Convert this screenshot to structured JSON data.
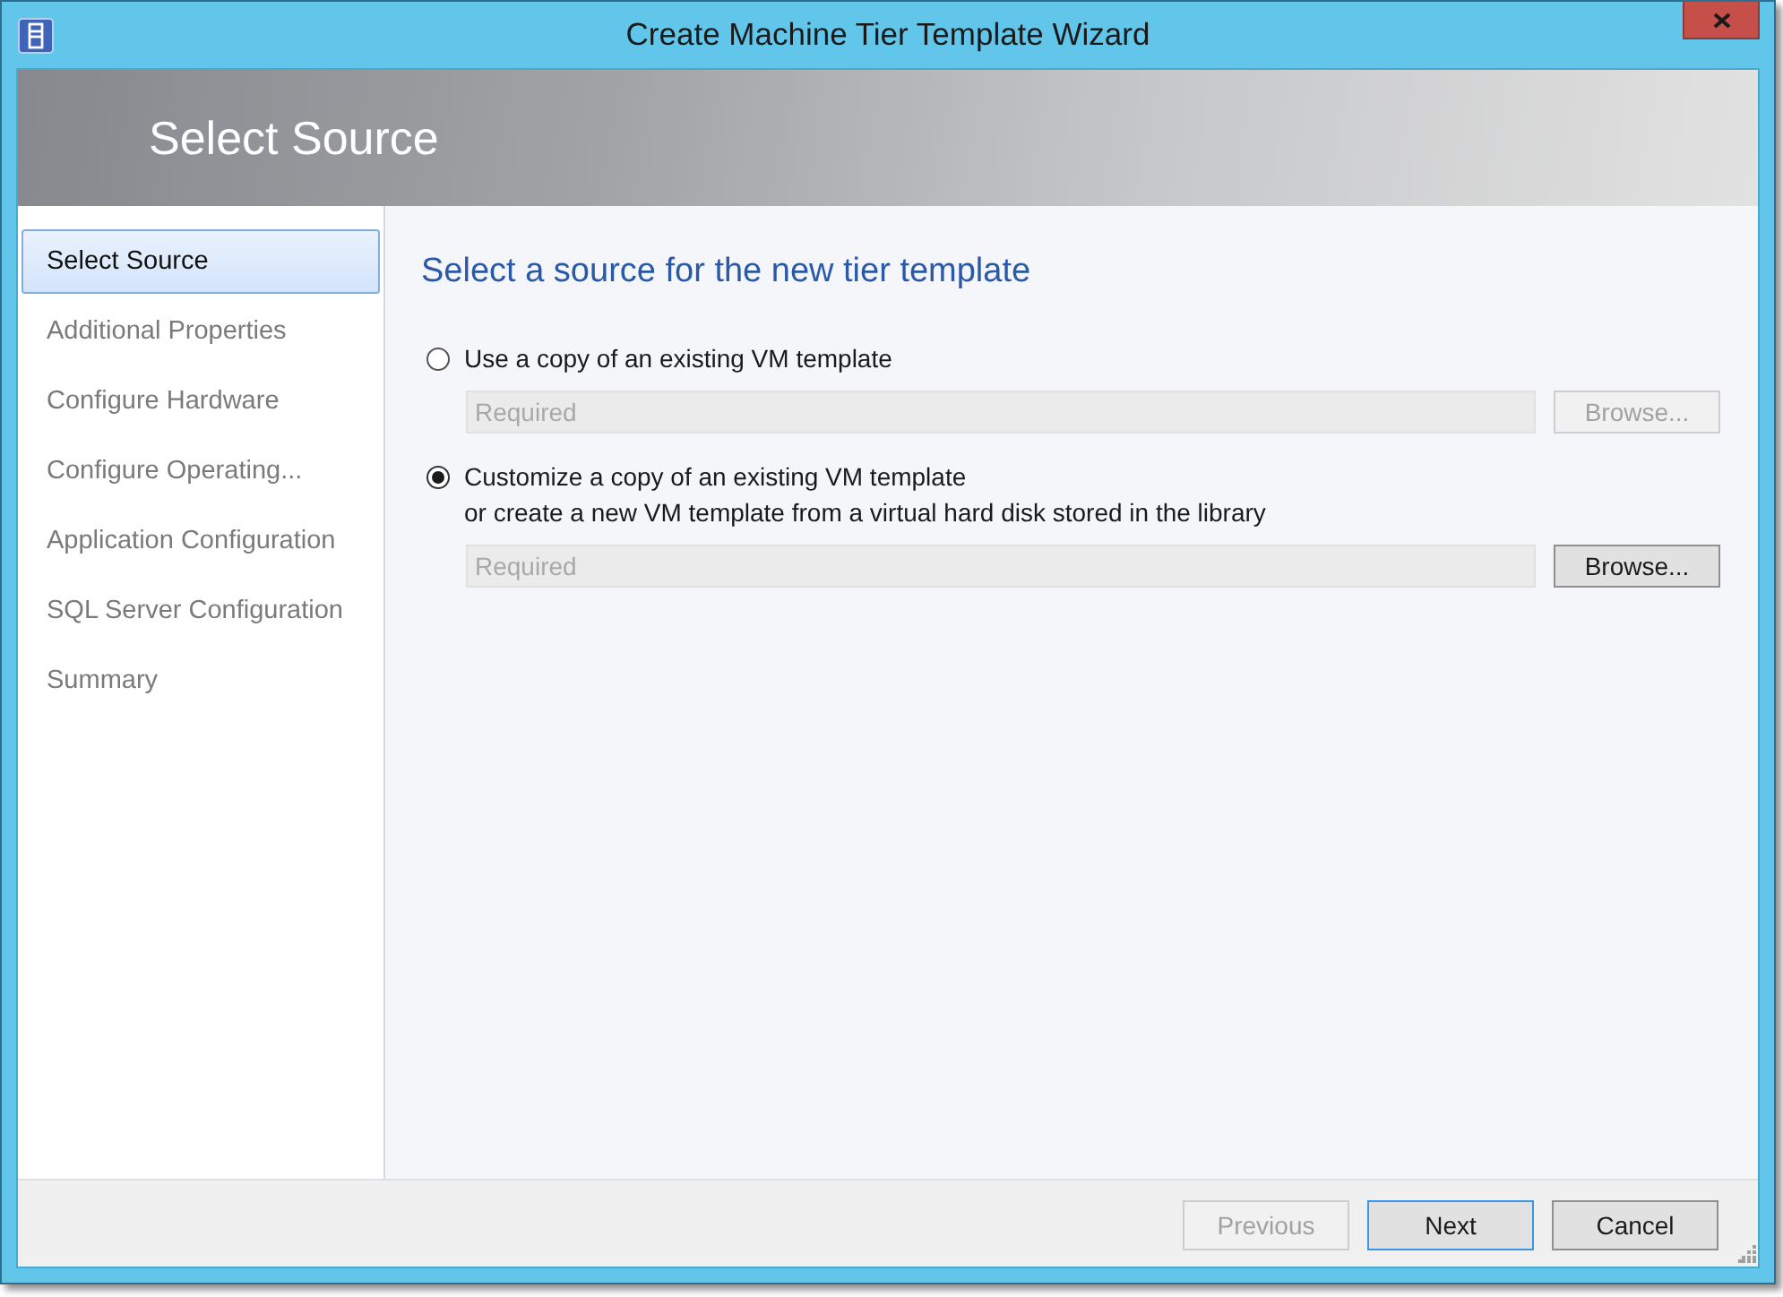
{
  "window": {
    "title": "Create Machine Tier Template Wizard"
  },
  "header": {
    "title": "Select Source"
  },
  "steps": [
    {
      "label": "Select Source",
      "selected": true
    },
    {
      "label": "Additional Properties",
      "selected": false
    },
    {
      "label": "Configure Hardware",
      "selected": false
    },
    {
      "label": "Configure Operating...",
      "selected": false
    },
    {
      "label": "Application Configuration",
      "selected": false
    },
    {
      "label": "SQL Server Configuration",
      "selected": false
    },
    {
      "label": "Summary",
      "selected": false
    }
  ],
  "content": {
    "heading": "Select a source for the new tier template",
    "options": [
      {
        "label": "Use a copy of an existing VM template",
        "selected": false,
        "field": {
          "placeholder": "Required"
        },
        "browse": {
          "label": "Browse...",
          "disabled": true
        }
      },
      {
        "label": "Customize a copy of an existing VM template",
        "detail": "or create a new VM template from a virtual hard disk stored in the library",
        "selected": true,
        "field": {
          "placeholder": "Required"
        },
        "browse": {
          "label": "Browse...",
          "disabled": false
        }
      }
    ]
  },
  "footer": {
    "buttons": [
      {
        "label": "Previous",
        "disabled": true,
        "default": false
      },
      {
        "label": "Next",
        "disabled": false,
        "default": true
      },
      {
        "label": "Cancel",
        "disabled": false,
        "default": false
      }
    ]
  }
}
